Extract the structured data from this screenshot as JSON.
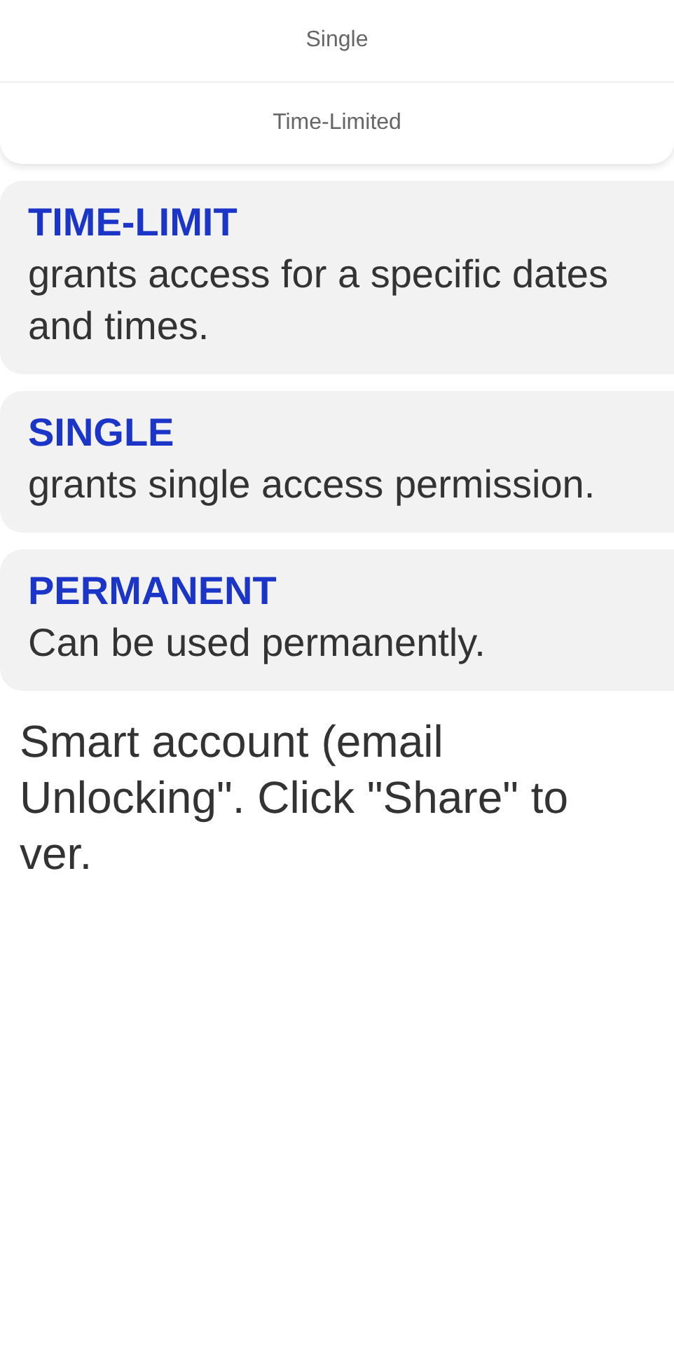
{
  "options": [
    {
      "label": "Single"
    },
    {
      "label": "Time-Limited"
    }
  ],
  "descriptions": [
    {
      "title": "TIME-LIMIT",
      "text": "grants access for a specific dates and times."
    },
    {
      "title": "SINGLE",
      "text": "grants single access permission."
    },
    {
      "title": "PERMANENT",
      "text": "Can be used permanently."
    }
  ],
  "note_lines": [
    "Smart account (email",
    "Unlocking\". Click \"Share\" to",
    "ver."
  ]
}
